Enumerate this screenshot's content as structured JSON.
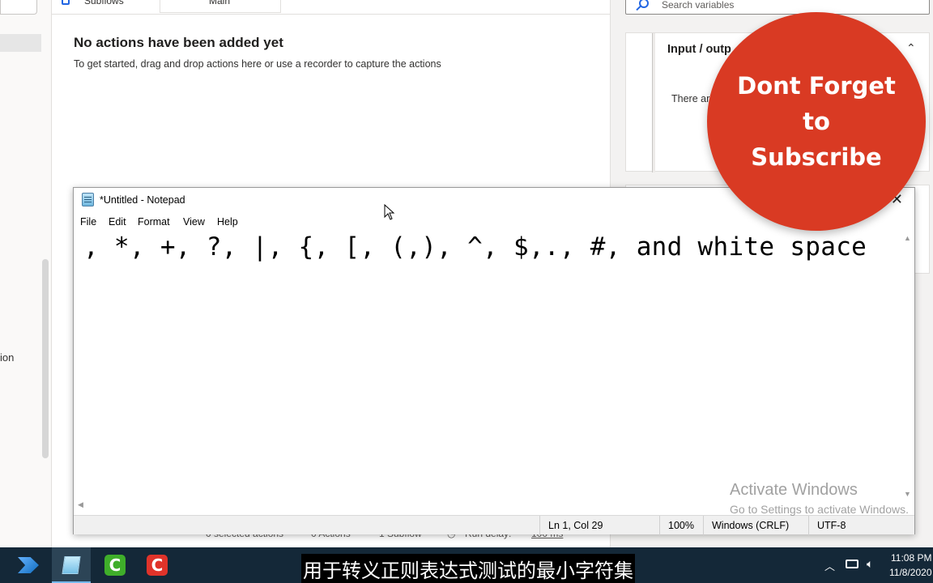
{
  "app": {
    "tabs": {
      "subflows": "Subflows",
      "main": "Main"
    },
    "empty_state": {
      "title": "No actions have been added yet",
      "subtitle": "To get started, drag and drop actions here or use a recorder to capture the actions"
    },
    "left_rail_label": "ion",
    "status": {
      "selected": "0 selected actions",
      "actions": "0 Actions",
      "subflow": "1 Subflow",
      "run_delay": "Run delay:",
      "run_delay_value": "100 ms"
    },
    "variables": {
      "search_placeholder": "Search variables",
      "io_title": "Input / outp",
      "io_body": "There ar"
    }
  },
  "notepad": {
    "title": "*Untitled - Notepad",
    "menu": [
      "File",
      "Edit",
      "Format",
      "View",
      "Help"
    ],
    "content": ", *, +, ?, |, {, [, (,), ^, $,., #, and white space",
    "status": {
      "position": "Ln 1, Col 29",
      "zoom": "100%",
      "line_ending": "Windows (CRLF)",
      "encoding": "UTF-8"
    }
  },
  "overlay": {
    "subscribe_lines": [
      "Dont Forget",
      "to",
      "Subscribe"
    ],
    "subscribe_color": "#d93a23",
    "watermark_title": "Activate Windows",
    "watermark_sub": "Go to Settings to activate Windows."
  },
  "subtitle": "用于转义正则表达式测试的最小字符集",
  "taskbar": {
    "apps": [
      "power-automate-icon",
      "notepad-icon",
      "camtasia-recorder-icon",
      "camtasia-editor-icon"
    ],
    "time": "11:08 PM",
    "date": "11/8/2020"
  }
}
